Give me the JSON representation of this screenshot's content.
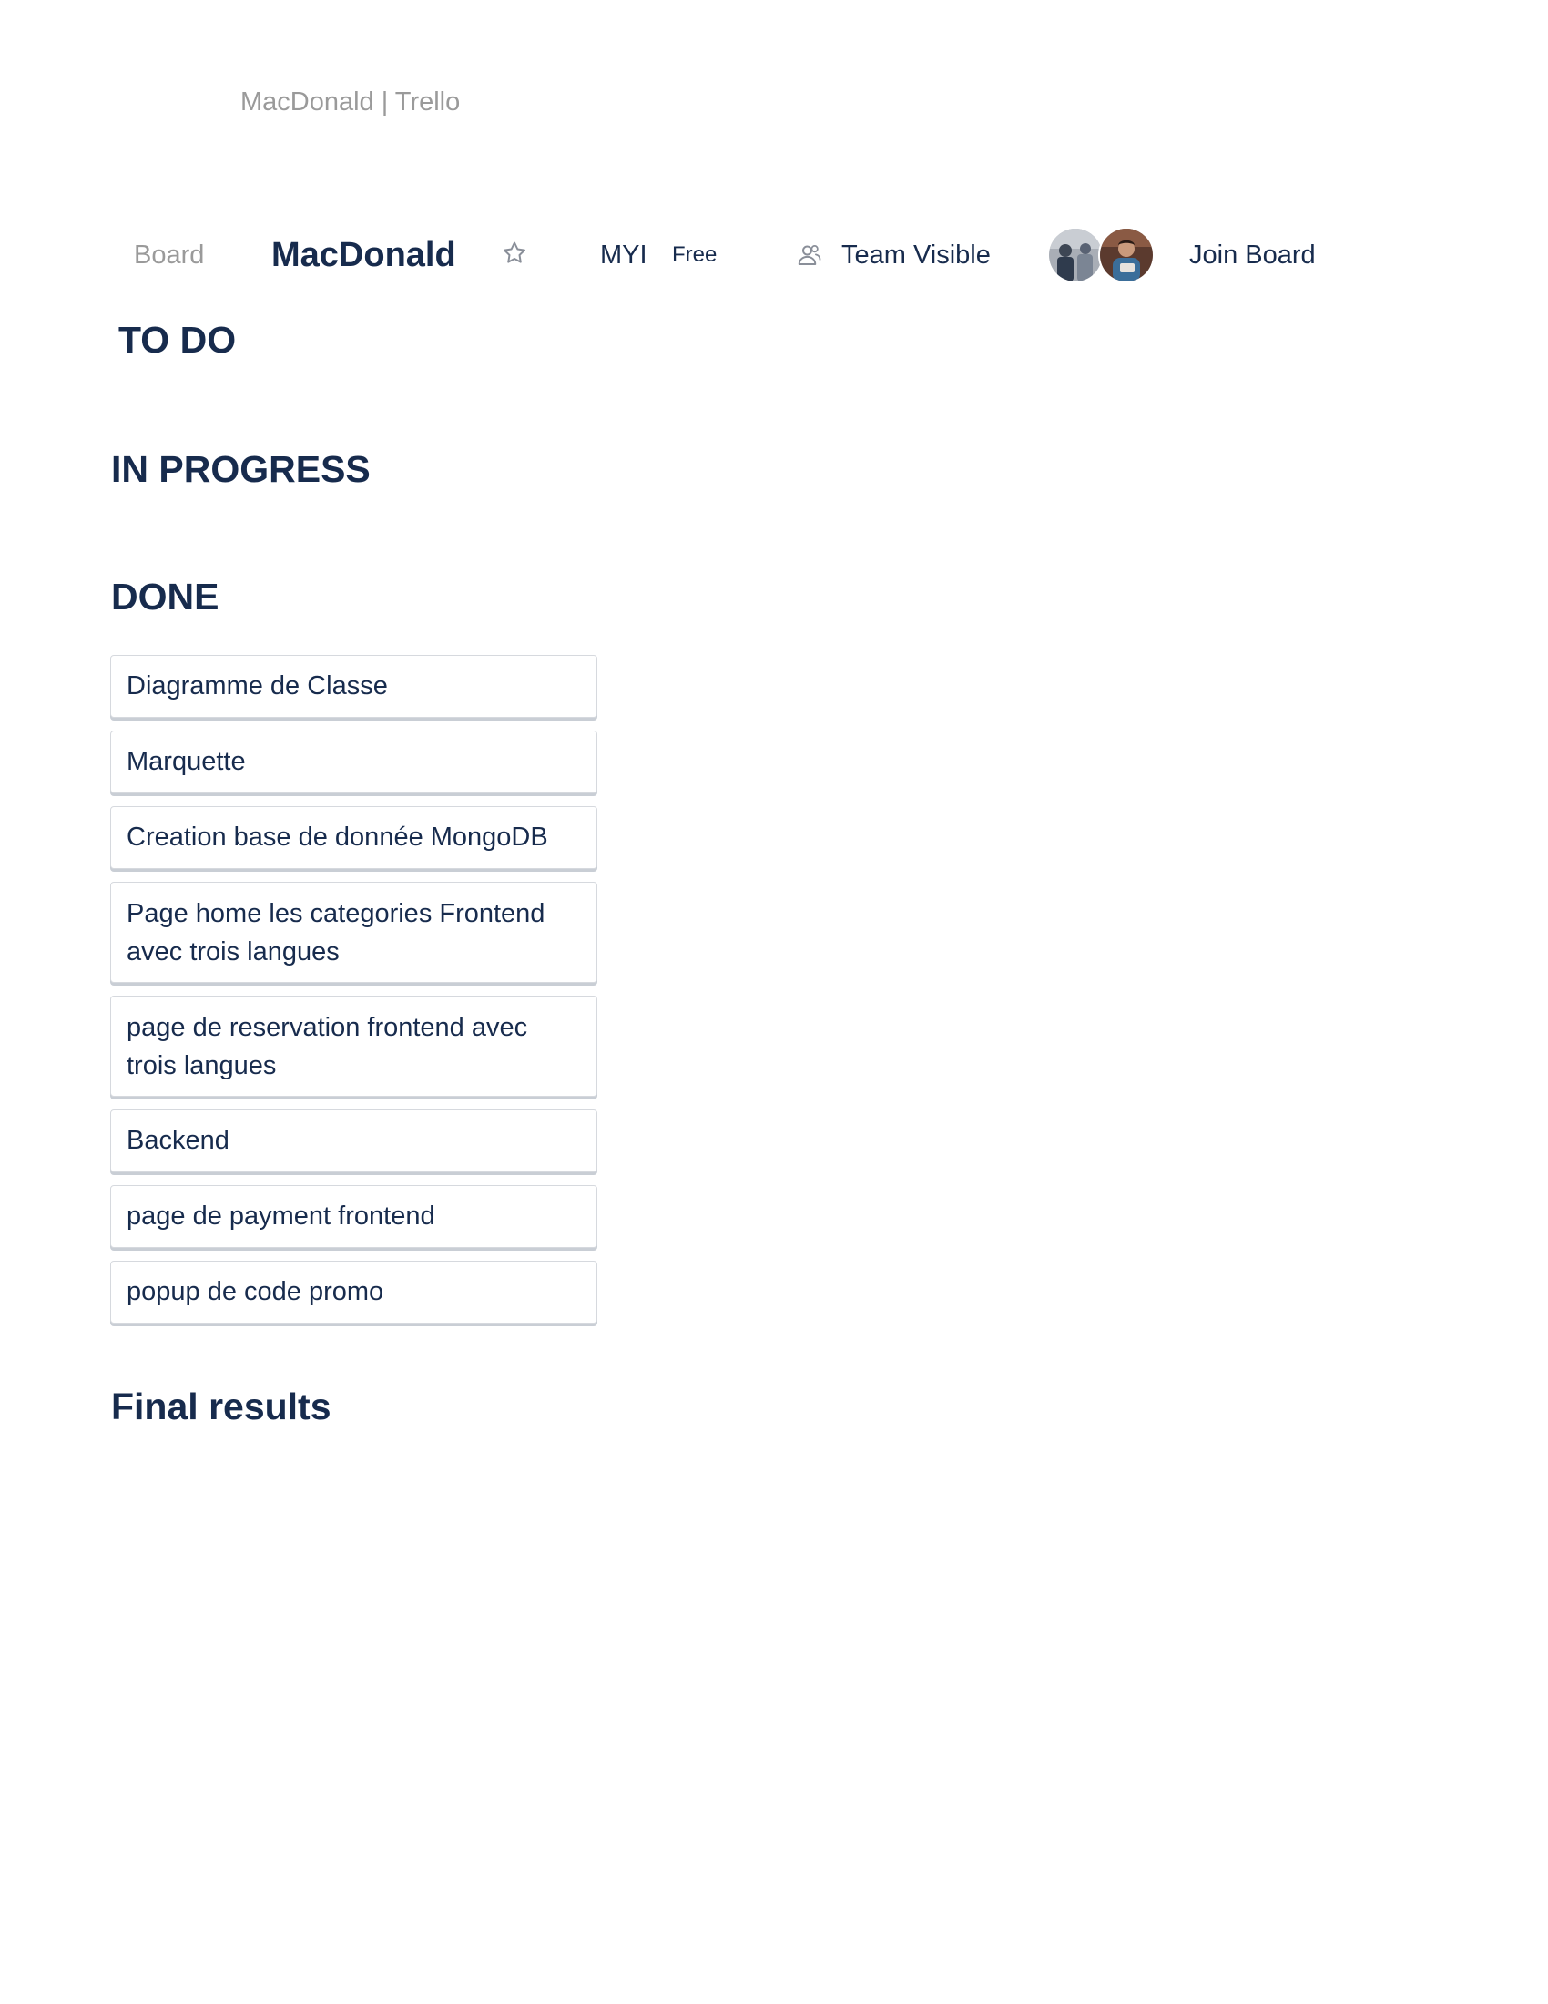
{
  "page": {
    "title": "MacDonald | Trello"
  },
  "header": {
    "board_label": "Board",
    "board_name": "MacDonald",
    "team": "MYI",
    "plan": "Free",
    "visibility": "Team Visible",
    "join_label": "Join Board",
    "icons": {
      "star": "star-icon",
      "visibility": "team-visibility-icon"
    },
    "member_count": 2
  },
  "lists": [
    {
      "title": "TO DO",
      "cards": []
    },
    {
      "title": "IN PROGRESS",
      "cards": []
    },
    {
      "title": "DONE",
      "cards": [
        "Diagramme de Classe",
        "Marquette",
        "Creation base de donnée MongoDB",
        "Page home les categories Frontend avec trois langues",
        "page de reservation frontend avec trois langues",
        "Backend",
        "page de payment frontend",
        "popup de code promo"
      ]
    },
    {
      "title": "Final results",
      "cards": []
    }
  ],
  "colors": {
    "text_primary": "#172b4d",
    "text_muted": "#9a9a9a",
    "card_border": "#d6d9de",
    "background": "#ffffff"
  }
}
